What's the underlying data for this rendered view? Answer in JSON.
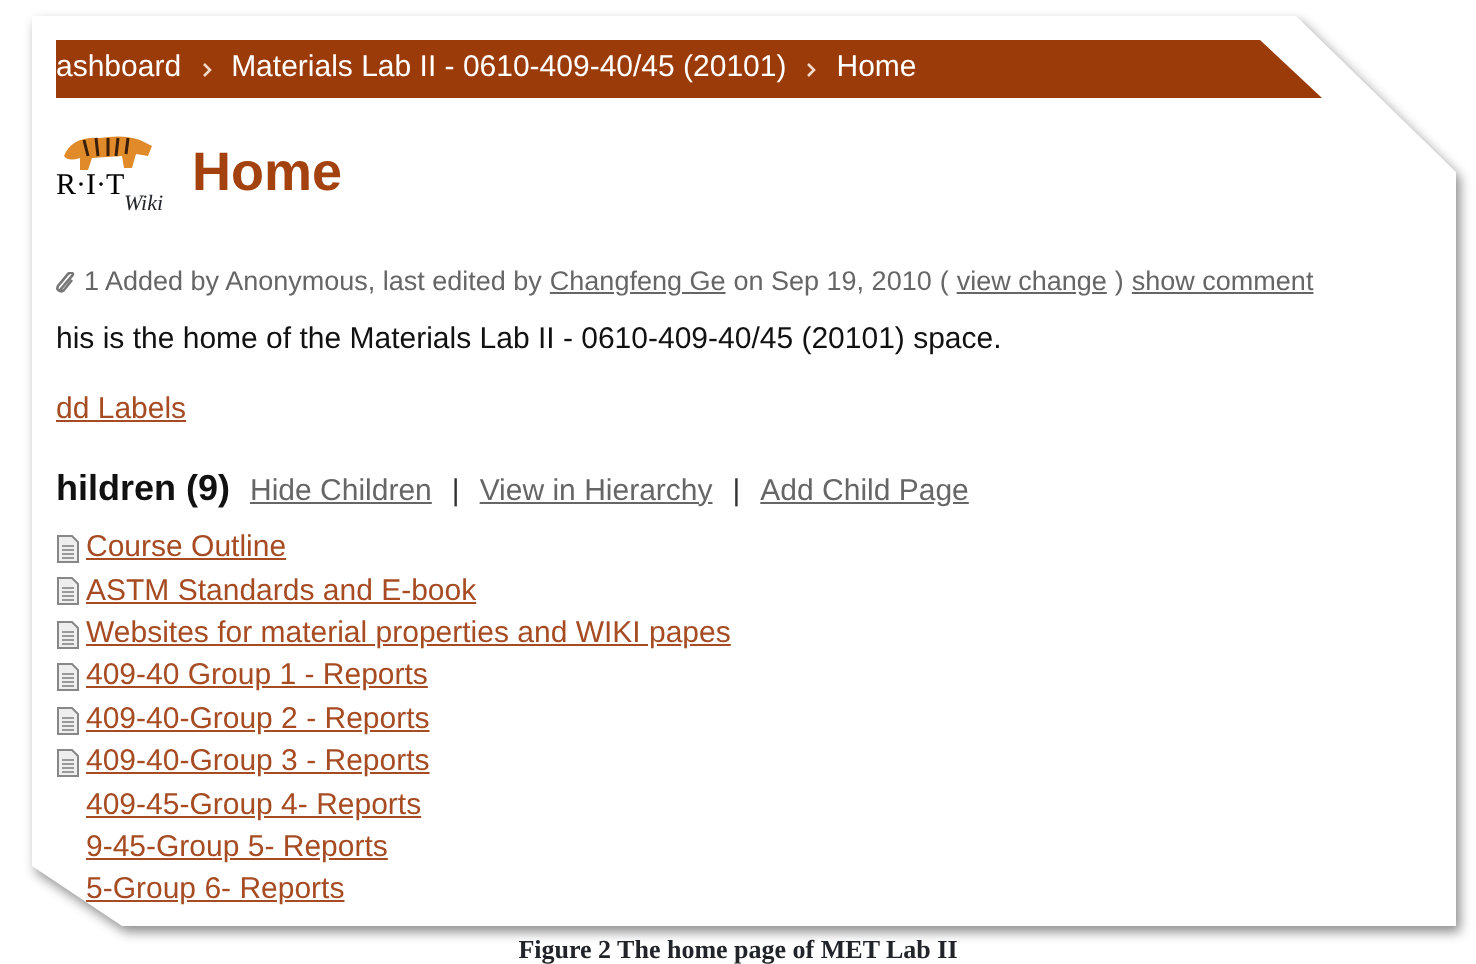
{
  "breadcrumbs": [
    {
      "label": "ashboard"
    },
    {
      "label": "Materials Lab II - 0610-409-40/45 (20101)"
    },
    {
      "label": "Home"
    }
  ],
  "logo": {
    "text": "R·I·T",
    "subtext": "Wiki"
  },
  "page_title": "Home",
  "meta": [
    {
      "kind": "text",
      "text": "1 Added by Anonymous, last edited by"
    },
    {
      "kind": "link",
      "text": "Changfeng Ge"
    },
    {
      "kind": "text",
      "text": "on Sep 19, 2010"
    },
    {
      "kind": "text",
      "text": "("
    },
    {
      "kind": "link",
      "text": "view change"
    },
    {
      "kind": "text",
      "text": ")"
    },
    {
      "kind": "link",
      "text": "show comment"
    }
  ],
  "intro": "his is the home of the Materials Lab II - 0610-409-40/45 (20101) space.",
  "add_labels": "dd Labels",
  "children": {
    "heading": "hildren (9)",
    "actions": [
      "Hide Children",
      "View in Hierarchy",
      "Add Child Page"
    ],
    "separator": "|",
    "items": [
      {
        "label": "Course Outline",
        "icon": true
      },
      {
        "label": "ASTM Standards and E-book",
        "icon": true
      },
      {
        "label": "Websites for material properties and WIKI papes",
        "icon": true
      },
      {
        "label": "409-40 Group 1 - Reports",
        "icon": true
      },
      {
        "label": "409-40-Group 2 - Reports",
        "icon": true
      },
      {
        "label": "409-40-Group 3 - Reports",
        "icon": true
      },
      {
        "label": "409-45-Group 4- Reports",
        "icon": false
      },
      {
        "label": "9-45-Group 5- Reports",
        "icon": false
      },
      {
        "label": "5-Group 6- Reports",
        "icon": false
      }
    ]
  },
  "caption": "Figure 2 The home page of MET Lab II"
}
